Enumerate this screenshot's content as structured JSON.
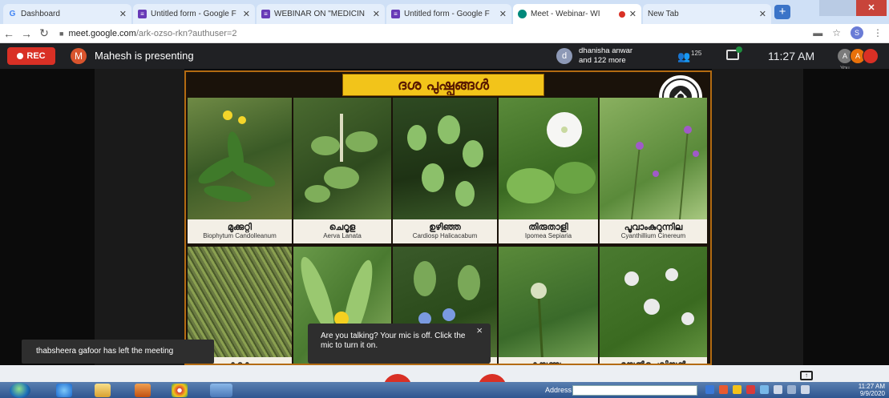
{
  "browser": {
    "tabs": [
      {
        "label": "Dashboard",
        "icon": "google-icon",
        "color": "#4285f4"
      },
      {
        "label": "Untitled form - Google F",
        "icon": "forms-icon",
        "color": "#673ab7"
      },
      {
        "label": "WEBINAR ON \"MEDICIN",
        "icon": "forms-icon",
        "color": "#673ab7"
      },
      {
        "label": "Untitled form - Google F",
        "icon": "forms-icon",
        "color": "#673ab7"
      },
      {
        "label": "Meet - Webinar- WI",
        "icon": "meet-icon",
        "color": "#00897b"
      },
      {
        "label": "New Tab",
        "icon": "",
        "color": ""
      }
    ],
    "url_host": "meet.google.com",
    "url_path": "/ark-ozso-rkn?authuser=2",
    "profile_initial": "S"
  },
  "meet": {
    "rec_label": "REC",
    "presenter_initial": "M",
    "presenting_text": "Mahesh is presenting",
    "participant_initial": "d",
    "participant_name": "dhanisha anwar",
    "participant_more": "and 122 more",
    "people_count": "125",
    "clock": "11:27 AM",
    "self_label": "You",
    "self_avatars": [
      {
        "text": "A",
        "color": "#7b7b7b"
      },
      {
        "text": "A",
        "color": "#e8710a"
      },
      {
        "text": "",
        "color": "#d93025"
      }
    ]
  },
  "slide": {
    "title": "ദശ പുഷ്പങ്ങൾ",
    "plants": [
      {
        "mal": "മുക്കുറ്റി",
        "lat": "Biophytum Candolleanum"
      },
      {
        "mal": "ചെറൂള",
        "lat": "Aerva Lanata"
      },
      {
        "mal": "ഉഴിഞ്ഞ",
        "lat": "Cardiosp Halicacabum"
      },
      {
        "mal": "തിരുതാളി",
        "lat": "Ipomea Sepiaria"
      },
      {
        "mal": "പൂവാംകുറുന്നില",
        "lat": "Cyanthillium Cinereum"
      },
      {
        "mal": "കറുക",
        "lat": ""
      },
      {
        "mal": "",
        "lat": ""
      },
      {
        "mal": "ി",
        "lat": ""
      },
      {
        "mal": "കയ്യുണ്യം",
        "lat": ""
      },
      {
        "mal": "മുയൽച്ചെവിയൻ",
        "lat": ""
      }
    ]
  },
  "toasts": {
    "left_message": "thabsheera gafoor has left the meeting",
    "mic_message": "Are you talking? Your mic is off. Click the mic to turn it on.",
    "mic_close": "×"
  },
  "taskbar": {
    "address_label": "Address",
    "time": "11:27 AM",
    "date": "9/9/2020"
  }
}
